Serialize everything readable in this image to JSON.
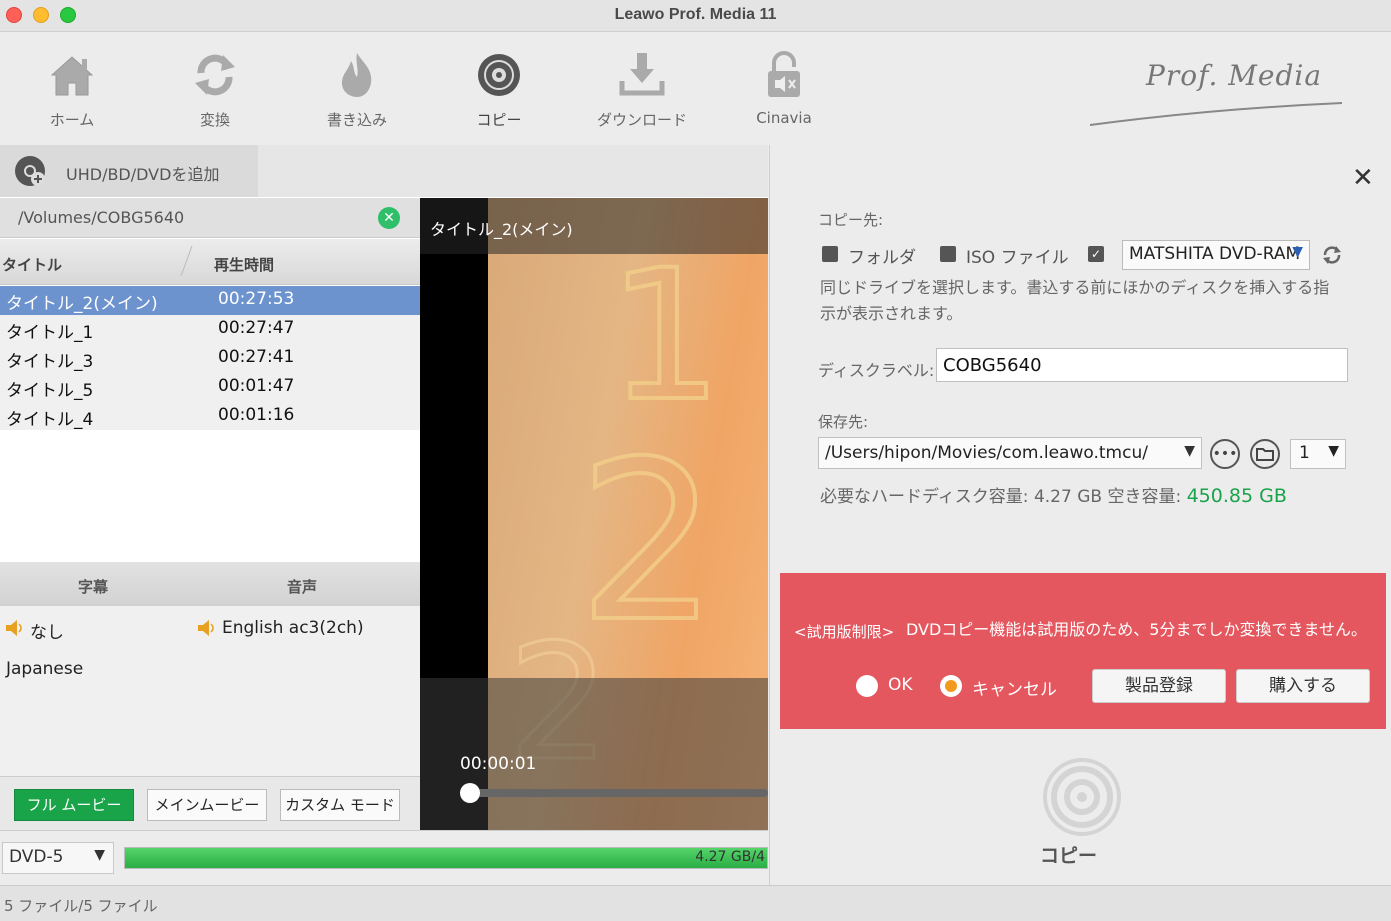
{
  "window": {
    "title": "Leawo Prof. Media 11"
  },
  "toolbar": {
    "items": [
      {
        "label": "ホーム",
        "icon": "home-icon"
      },
      {
        "label": "変換",
        "icon": "convert-icon"
      },
      {
        "label": "書き込み",
        "icon": "burn-icon"
      },
      {
        "label": "コピー",
        "icon": "copy-disc-icon"
      },
      {
        "label": "ダウンロード",
        "icon": "download-icon"
      },
      {
        "label": "Cinavia",
        "icon": "cinavia-icon"
      }
    ],
    "brand": "Prof. Media"
  },
  "left": {
    "add_label": "UHD/BD/DVDを追加",
    "path": "/Volumes/COBG5640",
    "col_title": "タイトル",
    "col_time": "再生時間",
    "titles": [
      {
        "name": "タイトル_2(メイン)",
        "time": "00:27:53",
        "selected": true
      },
      {
        "name": "タイトル_1",
        "time": "00:27:47"
      },
      {
        "name": "タイトル_3",
        "time": "00:27:41"
      },
      {
        "name": "タイトル_5",
        "time": "00:01:47"
      },
      {
        "name": "タイトル_4",
        "time": "00:01:16"
      }
    ],
    "col_subtitle": "字幕",
    "col_audio": "音声",
    "subtitles": [
      "なし",
      "Japanese"
    ],
    "audio": "English ac3(2ch)",
    "modes": [
      "フル ムービー",
      "メインムービー",
      "カスタム モード"
    ],
    "active_mode": "フル ムービー"
  },
  "video": {
    "title": "タイトル_2(メイン)",
    "time": "00:00:01"
  },
  "disc": {
    "type": "DVD-5",
    "size_text": "4.27 GB/4",
    "progress_percent": 100
  },
  "status": {
    "text": "5 ファイル/5 ファイル"
  },
  "right": {
    "copy_to_label": "コピー先:",
    "opt_folder": "フォルダ",
    "opt_iso": "ISO ファイル",
    "drive": "MATSHITA DVD-RAM",
    "hint": "同じドライブを選択します。書込する前にほかのディスクを挿入する指示が表示されます。",
    "disc_label_label": "ディスクラベル:",
    "disc_label_value": "COBG5640",
    "save_to_label": "保存先:",
    "save_path": "/Users/hipon/Movies/com.leawo.tmcu/",
    "copies": "1",
    "need_label": "必要なハードディスク容量:",
    "need_value": "4.27 GB",
    "free_label": "空き容量:",
    "free_value": "450.85 GB",
    "trial_tag": "<試用版制限>",
    "trial_msg": "DVDコピー機能は試用版のため、5分までしか変換できません。",
    "radio_ok": "OK",
    "radio_cancel": "キャンセル",
    "btn_register": "製品登録",
    "btn_buy": "購入する",
    "copy_label": "コピー"
  },
  "colors": {
    "accent_green": "#19a44a",
    "trial_red": "#e4575f",
    "selection_blue": "#6d93cf"
  }
}
